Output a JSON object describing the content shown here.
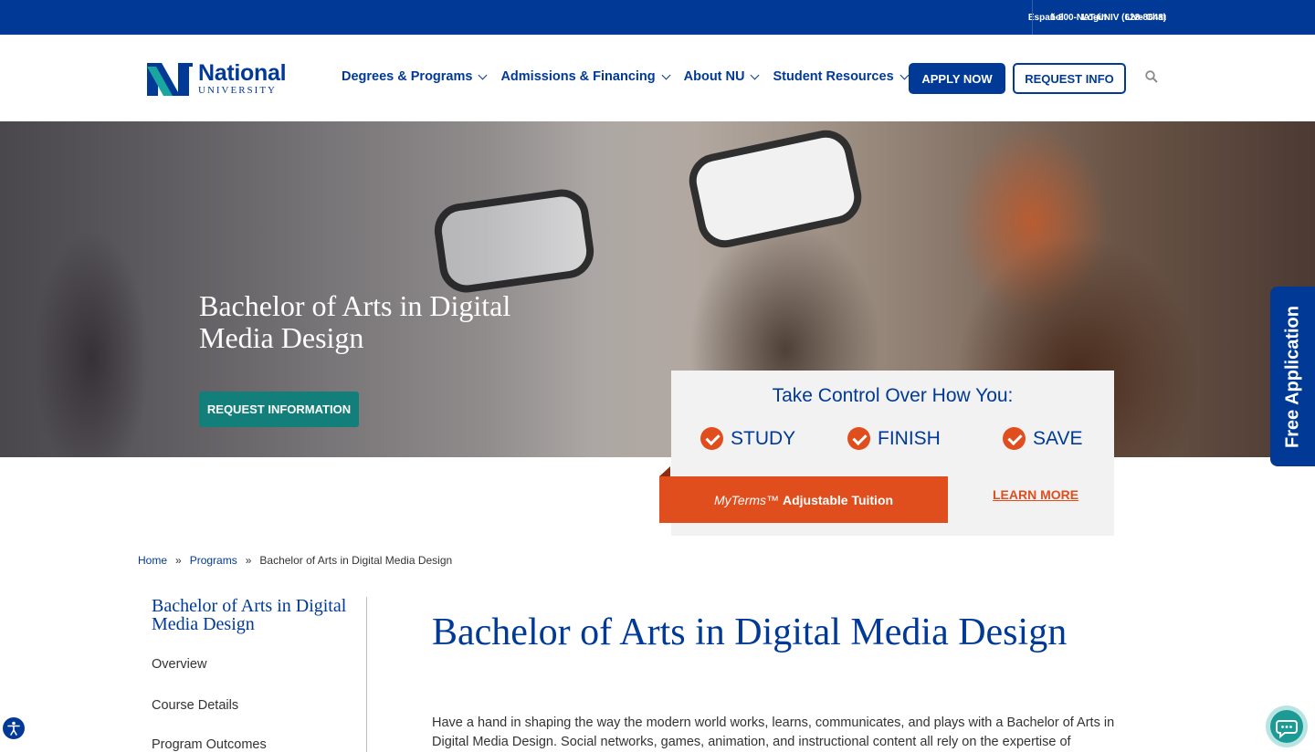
{
  "utility": {
    "links": [
      "Español",
      "Login",
      "Live Chat"
    ],
    "phone": "1-800-NAT-UNIV (628-8648)"
  },
  "logo": {
    "line1": "National",
    "line2": "UNIVERSITY"
  },
  "nav": {
    "items": [
      "Degrees & Programs",
      "Admissions & Financing",
      "About NU",
      "Student Resources"
    ],
    "apply": "APPLY NOW",
    "request_info": "REQUEST INFO"
  },
  "hero": {
    "title": "Bachelor of Arts in Digital Media Design",
    "cta": "REQUEST INFORMATION"
  },
  "promo": {
    "heading": "Take Control Over How You:",
    "options": [
      "STUDY",
      "FINISH",
      "SAVE"
    ],
    "brand": "MyTerms™",
    "tagline": "Adjustable Tuition",
    "learn_more": "LEARN MORE"
  },
  "free_app": "Free Application",
  "breadcrumb": [
    "Home",
    "Programs",
    "Bachelor of Arts in Digital Media Design"
  ],
  "breadcrumb_sep": "»",
  "sidebar": {
    "title": "Bachelor of Arts in Digital Media Design",
    "items": [
      "Overview",
      "Course Details",
      "Program Outcomes"
    ]
  },
  "main": {
    "title": "Bachelor of Arts in Digital Media Design",
    "intro": "Have a hand in shaping the way the modern world works, learns, communicates, and plays with a Bachelor of Arts in Digital Media Design. Social networks, games, animation, and instructional content all rely on the expertise of"
  },
  "colors": {
    "brand_blue": "#003a96",
    "accent_orange": "#e04e1e",
    "teal": "#137f7a"
  }
}
